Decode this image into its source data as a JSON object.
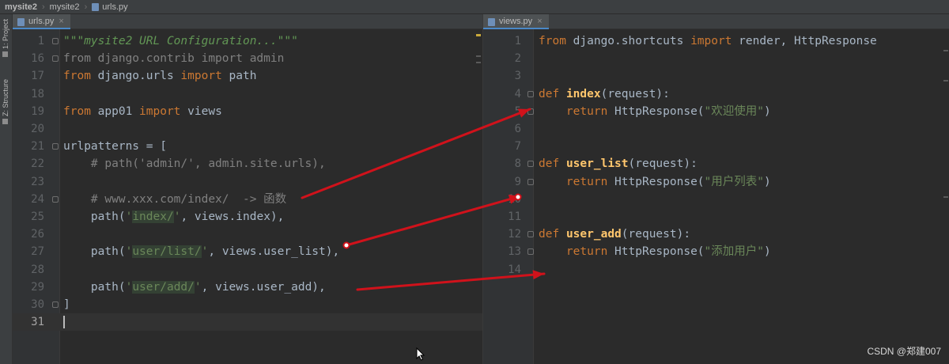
{
  "breadcrumb": {
    "items": [
      "mysite2",
      "mysite2",
      "urls.py"
    ]
  },
  "side_tabs": {
    "project": "1: Project",
    "structure": "Z: Structure"
  },
  "left_editor": {
    "tab_label": "urls.py",
    "lines": [
      {
        "n": "1",
        "tokens": [
          {
            "t": "\"\"\"mysite2 URL Configuration...\"\"\"",
            "c": "doc"
          }
        ]
      },
      {
        "n": "16",
        "tokens": [
          {
            "t": "from django.contrib import admin",
            "c": "cmt"
          }
        ]
      },
      {
        "n": "17",
        "tokens": [
          {
            "t": "from",
            "c": "kw"
          },
          {
            "t": " django.urls ",
            "c": "ident"
          },
          {
            "t": "import",
            "c": "kw"
          },
          {
            "t": " path",
            "c": "ident"
          }
        ]
      },
      {
        "n": "18",
        "tokens": []
      },
      {
        "n": "19",
        "tokens": [
          {
            "t": "from",
            "c": "kw"
          },
          {
            "t": " app01 ",
            "c": "ident"
          },
          {
            "t": "import",
            "c": "kw"
          },
          {
            "t": " views",
            "c": "ident"
          }
        ]
      },
      {
        "n": "20",
        "tokens": []
      },
      {
        "n": "21",
        "tokens": [
          {
            "t": "urlpatterns = [",
            "c": "ident"
          }
        ]
      },
      {
        "n": "22",
        "tokens": [
          {
            "t": "    # path('admin/', admin.site.urls),",
            "c": "cmt"
          }
        ]
      },
      {
        "n": "23",
        "tokens": []
      },
      {
        "n": "24",
        "tokens": [
          {
            "t": "    # www.xxx.com/index/  -> 函数",
            "c": "cmt"
          }
        ]
      },
      {
        "n": "25",
        "tokens": [
          {
            "t": "    path(",
            "c": "ident"
          },
          {
            "t": "'",
            "c": "str"
          },
          {
            "t": "index/",
            "c": "strhl"
          },
          {
            "t": "'",
            "c": "str"
          },
          {
            "t": ", views.index),",
            "c": "ident"
          }
        ]
      },
      {
        "n": "26",
        "tokens": []
      },
      {
        "n": "27",
        "tokens": [
          {
            "t": "    path(",
            "c": "ident"
          },
          {
            "t": "'",
            "c": "str"
          },
          {
            "t": "user/list/",
            "c": "strhl"
          },
          {
            "t": "'",
            "c": "str"
          },
          {
            "t": ", views.user_list),",
            "c": "ident"
          }
        ]
      },
      {
        "n": "28",
        "tokens": []
      },
      {
        "n": "29",
        "tokens": [
          {
            "t": "    path(",
            "c": "ident"
          },
          {
            "t": "'",
            "c": "str"
          },
          {
            "t": "user/add/",
            "c": "strhl"
          },
          {
            "t": "'",
            "c": "str"
          },
          {
            "t": ", views.user_add),",
            "c": "ident"
          }
        ]
      },
      {
        "n": "30",
        "tokens": [
          {
            "t": "]",
            "c": "ident"
          }
        ]
      },
      {
        "n": "31",
        "tokens": [],
        "current": true
      }
    ]
  },
  "right_editor": {
    "tab_label": "views.py",
    "lines": [
      {
        "n": "1",
        "tokens": [
          {
            "t": "from",
            "c": "kw"
          },
          {
            "t": " django.shortcuts ",
            "c": "ident"
          },
          {
            "t": "import",
            "c": "kw"
          },
          {
            "t": " render, HttpResponse",
            "c": "ident"
          }
        ]
      },
      {
        "n": "2",
        "tokens": []
      },
      {
        "n": "3",
        "tokens": []
      },
      {
        "n": "4",
        "tokens": [
          {
            "t": "def",
            "c": "kw"
          },
          {
            "t": " ",
            "c": "ident"
          },
          {
            "t": "index",
            "c": "def"
          },
          {
            "t": "(request):",
            "c": "ident"
          }
        ]
      },
      {
        "n": "5",
        "tokens": [
          {
            "t": "    ",
            "c": "ident"
          },
          {
            "t": "return",
            "c": "kw"
          },
          {
            "t": " HttpResponse(",
            "c": "ident"
          },
          {
            "t": "\"欢迎使用\"",
            "c": "str"
          },
          {
            "t": ")",
            "c": "ident"
          }
        ]
      },
      {
        "n": "6",
        "tokens": []
      },
      {
        "n": "7",
        "tokens": []
      },
      {
        "n": "8",
        "tokens": [
          {
            "t": "def",
            "c": "kw"
          },
          {
            "t": " ",
            "c": "ident"
          },
          {
            "t": "user_list",
            "c": "def"
          },
          {
            "t": "(request):",
            "c": "ident"
          }
        ]
      },
      {
        "n": "9",
        "tokens": [
          {
            "t": "    ",
            "c": "ident"
          },
          {
            "t": "return",
            "c": "kw"
          },
          {
            "t": " HttpResponse(",
            "c": "ident"
          },
          {
            "t": "\"用户列表\"",
            "c": "str"
          },
          {
            "t": ")",
            "c": "ident"
          }
        ]
      },
      {
        "n": "10",
        "tokens": []
      },
      {
        "n": "11",
        "tokens": []
      },
      {
        "n": "12",
        "tokens": [
          {
            "t": "def",
            "c": "kw"
          },
          {
            "t": " ",
            "c": "ident"
          },
          {
            "t": "user_add",
            "c": "def"
          },
          {
            "t": "(request):",
            "c": "ident"
          }
        ]
      },
      {
        "n": "13",
        "tokens": [
          {
            "t": "    ",
            "c": "ident"
          },
          {
            "t": "return",
            "c": "kw"
          },
          {
            "t": " HttpResponse(",
            "c": "ident"
          },
          {
            "t": "\"添加用户\"",
            "c": "str"
          },
          {
            "t": ")",
            "c": "ident"
          }
        ]
      },
      {
        "n": "14",
        "tokens": []
      }
    ]
  },
  "annotation_color": "#d0121b",
  "watermark": "CSDN @郑建007"
}
